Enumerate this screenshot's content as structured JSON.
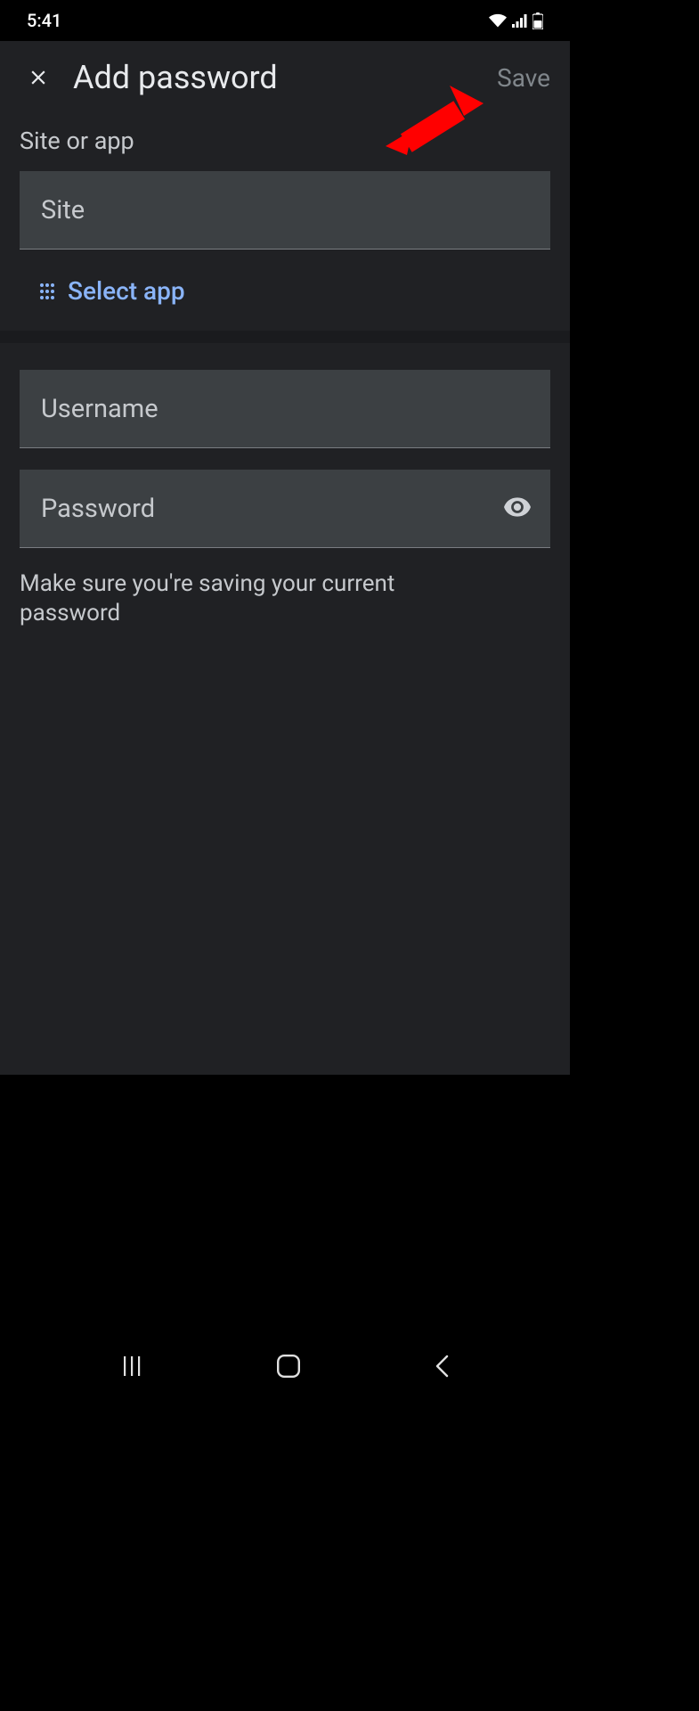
{
  "status": {
    "time": "5:41"
  },
  "header": {
    "title": "Add password",
    "save": "Save"
  },
  "form": {
    "site_label": "Site or app",
    "site_placeholder": "Site",
    "select_app": "Select app",
    "username_placeholder": "Username",
    "password_placeholder": "Password",
    "helper": "Make sure you're saving your current password"
  }
}
